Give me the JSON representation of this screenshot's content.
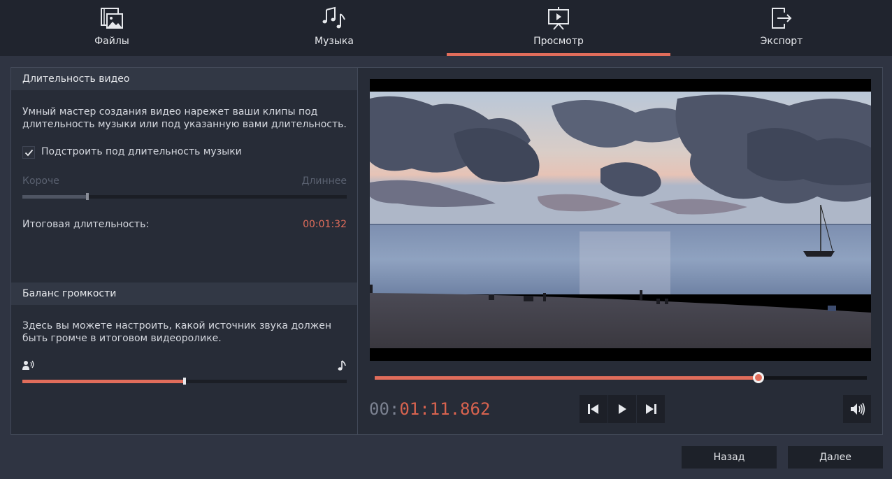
{
  "tabs": [
    {
      "label": "Файлы",
      "icon": "files-icon",
      "active": false
    },
    {
      "label": "Музыка",
      "icon": "music-icon",
      "active": false
    },
    {
      "label": "Просмотр",
      "icon": "preview-icon",
      "active": true
    },
    {
      "label": "Экспорт",
      "icon": "export-icon",
      "active": false
    }
  ],
  "duration_section": {
    "title": "Длительность видео",
    "description_line1": "Умный мастер создания видео нарежет ваши клипы под",
    "description_line2": "длительность музыки или под указанную вами длительность.",
    "fit_checkbox_label": "Подстроить под длительность музыки",
    "fit_checkbox_checked": true,
    "shorter_label": "Короче",
    "longer_label": "Длиннее",
    "duration_slider_value": 0.2,
    "total_label": "Итоговая длительность:",
    "total_value": "00:01:32"
  },
  "volume_section": {
    "title": "Баланс громкости",
    "description_line1": "Здесь вы можете настроить, какой источник звука должен",
    "description_line2": "быть громче в итоговом видеоролике.",
    "left_icon": "voice-icon",
    "right_icon": "music-note-icon",
    "balance_value": 0.5
  },
  "player": {
    "progress": 0.78,
    "timecode_dim": "00:",
    "timecode_hi": "01:11.862",
    "controls": [
      "previous-icon",
      "play-icon",
      "next-icon"
    ],
    "volume_icon": "speaker-icon"
  },
  "buttons": {
    "back": "Назад",
    "next": "Далее"
  },
  "colors": {
    "accent": "#e16d5b",
    "background": "#2f3442",
    "panel": "#272c37"
  }
}
